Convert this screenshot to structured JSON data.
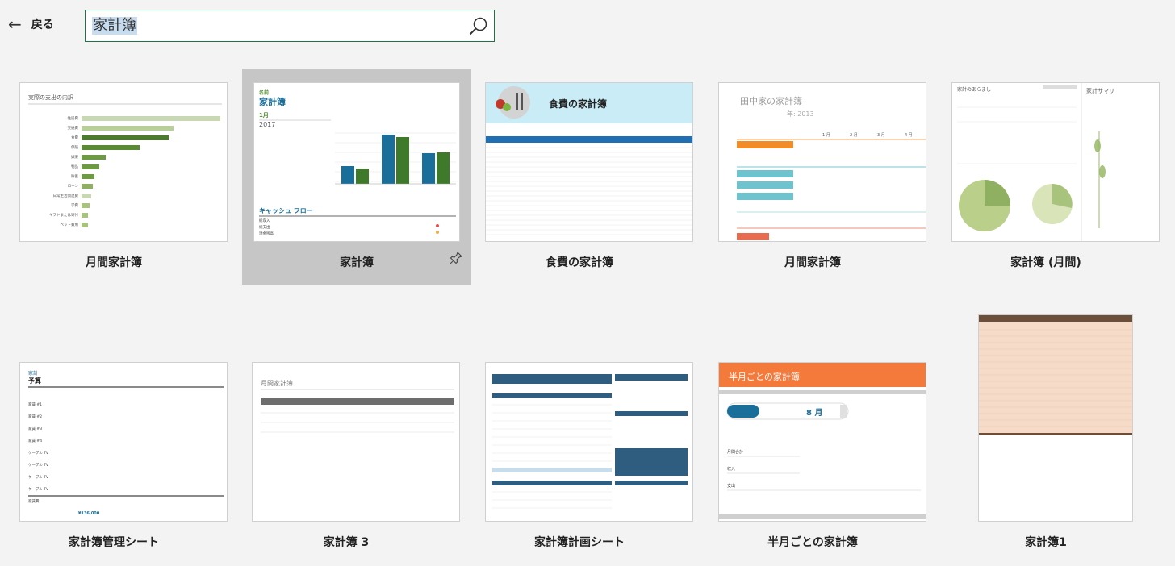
{
  "header": {
    "back_label": "戻る",
    "search": {
      "value": "家計簿"
    }
  },
  "templates": [
    {
      "label": "月間家計簿"
    },
    {
      "label": "家計簿"
    },
    {
      "label": "食費の家計簿"
    },
    {
      "label": "月間家計簿"
    },
    {
      "label": "家計簿 (月間)"
    },
    {
      "label": "家計簿管理シート"
    },
    {
      "label": "家計簿 3"
    },
    {
      "label": "家計簿計画シート"
    },
    {
      "label": "半月ごとの家計簿"
    },
    {
      "label": "家計簿1"
    }
  ],
  "thumbs": {
    "t1": {
      "title": "実際の支出の内訳",
      "rows": [
        "住居費",
        "交通費",
        "食費",
        "保険",
        "娯楽",
        "物品",
        "貯蓄",
        "ローン",
        "日常生活関連費",
        "学費",
        "ギフトまたは寄付",
        "ペット費用"
      ]
    },
    "t2": {
      "sub": "名前",
      "title": "家計簿",
      "month": "1月",
      "year": "2017",
      "section": "キャッシュ フロー",
      "rows": [
        "総収入",
        "総支出",
        "現金残高"
      ]
    },
    "t3": {
      "title": "食費の家計簿"
    },
    "t4": {
      "title": "田中家の家計簿",
      "year": "年: 2013",
      "months": [
        "1 月",
        "2 月",
        "3 月",
        "4 月"
      ]
    },
    "t5": {
      "title_a": "家計のあらまし",
      "title_b": "家計サマリ"
    },
    "t6": {
      "sub": "家計",
      "title": "予算",
      "rows": [
        "家賃 #1",
        "家賃 #2",
        "家賃 #3",
        "家賃 #4",
        "ケーブル TV",
        "ケーブル TV",
        "ケーブル TV",
        "ケーブル TV",
        "家賃費"
      ],
      "total": "¥136,000"
    },
    "t7": {
      "title": "月間家計簿"
    },
    "t9": {
      "title": "半月ごとの家計簿",
      "month": "8 月",
      "rows": [
        "月間合計",
        "収入",
        "支出"
      ]
    }
  },
  "colors": {
    "accent": "#217346",
    "blue": "#1a6e9a",
    "green": "#4c8a2e",
    "orange": "#f28c28"
  }
}
